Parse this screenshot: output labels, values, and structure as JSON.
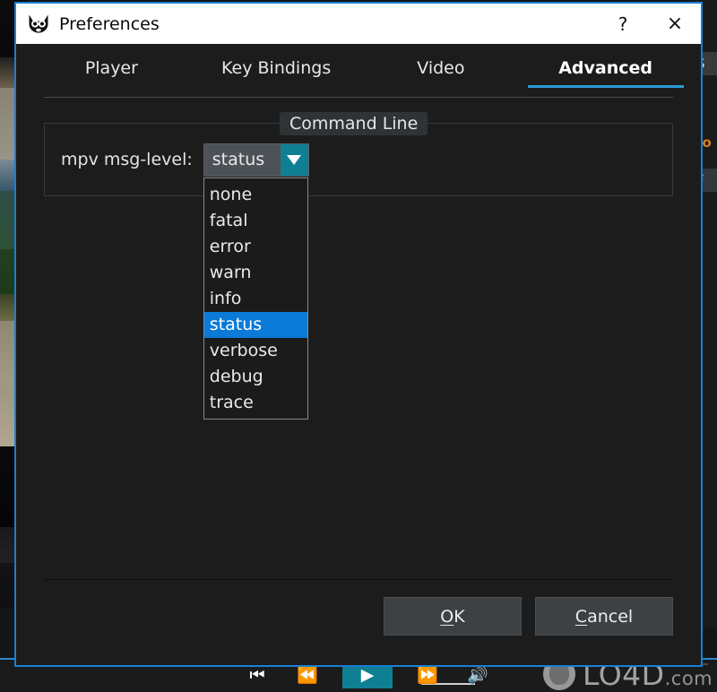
{
  "window": {
    "title": "Preferences",
    "icon": "mpv-cat-logo-icon",
    "help_label": "?",
    "close_label": "×",
    "border_color": "#1a7fd4"
  },
  "tabs": [
    {
      "label": "Player",
      "active": false
    },
    {
      "label": "Key Bindings",
      "active": false
    },
    {
      "label": "Video",
      "active": false
    },
    {
      "label": "Advanced",
      "active": true
    }
  ],
  "group": {
    "title": "Command Line",
    "field": {
      "label": "mpv msg-level:",
      "value": "status",
      "arrow_icon": "chevron-down-icon",
      "arrow_color": "#0f7f94",
      "options": [
        "none",
        "fatal",
        "error",
        "warn",
        "info",
        "status",
        "verbose",
        "debug",
        "trace"
      ],
      "selected_option": "status",
      "highlight_color": "#0b7ad8",
      "dropdown_open": true
    }
  },
  "footer": {
    "ok_label": "OK",
    "ok_mnemonic": "O",
    "cancel_label": "Cancel",
    "cancel_mnemonic": "C"
  },
  "background": {
    "watermark": {
      "text": "LO4D",
      "suffix": ".com",
      "logo": "lo4d-circle-logo-icon"
    },
    "player_controls": [
      {
        "name": "previous-button",
        "glyph": "⏮"
      },
      {
        "name": "rewind-button",
        "glyph": "⏪"
      },
      {
        "name": "play-button",
        "glyph": "▶"
      },
      {
        "name": "fast-forward-button",
        "glyph": "⏩"
      },
      {
        "name": "volume-button",
        "glyph": "🔊"
      }
    ],
    "right_panel_rows": [
      {
        "text": "S",
        "kind": "hdr"
      },
      {
        "text": "",
        "kind": "plain"
      },
      {
        "text": "fo",
        "kind": "accent"
      },
      {
        "text": "F",
        "kind": "field"
      }
    ]
  }
}
